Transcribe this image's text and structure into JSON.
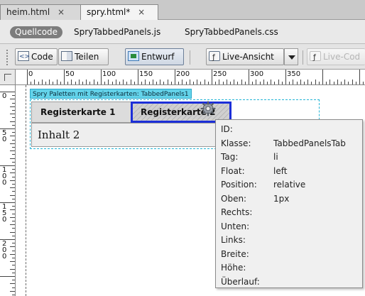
{
  "document_tabs": [
    {
      "label": "heim.html",
      "close": "×"
    },
    {
      "label": "spry.html*",
      "close": "×"
    }
  ],
  "related_files": {
    "source_label": "Quellcode",
    "files": [
      "SpryTabbedPanels.js",
      "SpryTabbedPanels.css"
    ]
  },
  "toolbar": {
    "code_label": "Code",
    "split_label": "Teilen",
    "design_label": "Entwurf",
    "live_view_label": "Live-Ansicht",
    "live_code_label": "Live-Cod"
  },
  "ruler": {
    "h_labels": [
      "0",
      "50",
      "100",
      "150",
      "200",
      "250",
      "300",
      "350"
    ],
    "v_labels": [
      "0",
      "50",
      "100",
      "150",
      "200"
    ]
  },
  "canvas": {
    "widget_label": "Spry Paletten mit Registerkarten: TabbedPanels1",
    "tab1_label": "Registerkarte 1",
    "tab2_label": "Registerkarte 2",
    "content_text": "Inhalt 2"
  },
  "tooltip": {
    "rows": [
      {
        "key": "ID:",
        "value": ""
      },
      {
        "key": "Klasse:",
        "value": "TabbedPanelsTab"
      },
      {
        "key": "Tag:",
        "value": "li"
      },
      {
        "key": "Float:",
        "value": "left"
      },
      {
        "key": "Position:",
        "value": "relative"
      },
      {
        "key": "Oben:",
        "value": "1px"
      },
      {
        "key": "Rechts:",
        "value": ""
      },
      {
        "key": "Unten:",
        "value": ""
      },
      {
        "key": "Links:",
        "value": ""
      },
      {
        "key": "Breite:",
        "value": ""
      },
      {
        "key": "Höhe:",
        "value": ""
      },
      {
        "key": "Überlauf:",
        "value": ""
      }
    ]
  },
  "colors": {
    "selection_border": "#1c2fd8",
    "spry_label_bg": "#63d3ea",
    "tooltip_bg": "#f0f0f0"
  }
}
